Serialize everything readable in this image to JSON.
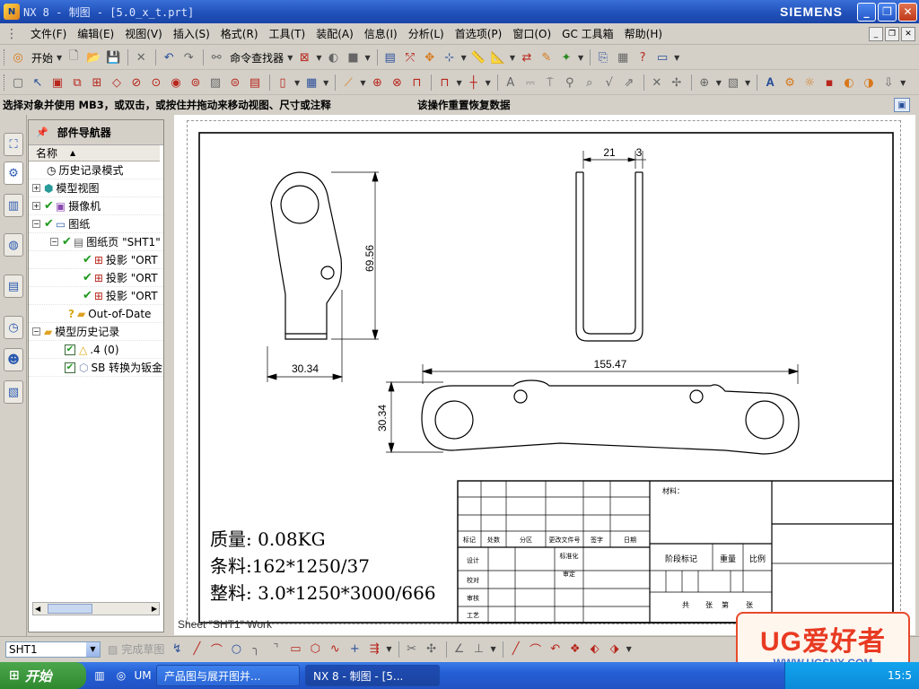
{
  "window": {
    "title": "NX 8 - 制图 - [5.0_x_t.prt]",
    "brand": "SIEMENS",
    "buttons": {
      "minimize": "_",
      "restore": "❐",
      "close": "✕"
    }
  },
  "menu": {
    "items": [
      "文件(F)",
      "编辑(E)",
      "视图(V)",
      "插入(S)",
      "格式(R)",
      "工具(T)",
      "装配(A)",
      "信息(I)",
      "分析(L)",
      "首选项(P)",
      "窗口(O)",
      "GC 工具箱",
      "帮助(H)"
    ]
  },
  "toolbar1": {
    "start_label": "开始",
    "command_finder_label": "命令查找器"
  },
  "status": {
    "cue": "选择对象并使用 MB3，或双击，或按住并拖动来移动视图、尺寸或注释",
    "message": "该操作重置恢复数据"
  },
  "navigator": {
    "title": "部件导航器",
    "column_header": "名称",
    "rows": [
      {
        "label": "历史记录模式"
      },
      {
        "label": "模型视图"
      },
      {
        "label": "摄像机"
      },
      {
        "label": "图纸"
      },
      {
        "label": "图纸页 \"SHT1\""
      },
      {
        "label": "投影 \"ORT"
      },
      {
        "label": "投影 \"ORT"
      },
      {
        "label": "投影 \"ORT"
      },
      {
        "label": "Out-of-Date"
      },
      {
        "label": "模型历史记录"
      },
      {
        "label": ".4 (0)"
      },
      {
        "label": "SB 转换为钣金"
      }
    ]
  },
  "drawing": {
    "dimensions": {
      "top_width": "21",
      "top_thickness": "3",
      "side_height": "69.56",
      "side_width": "30.34",
      "flat_length": "155.47",
      "flat_height": "30.34"
    },
    "notes": {
      "mass": "质量: 0.08KG",
      "strip": "条料:162*1250/37",
      "sheet": "整料: 3.0*1250*3000/666"
    },
    "title_block": {
      "material": "材料：",
      "headers": [
        "标记",
        "处数",
        "分区",
        "更改文件号",
        "签字",
        "日期"
      ],
      "roles": [
        "设计",
        "校对",
        "审核",
        "工艺"
      ],
      "standardize": "标准化",
      "approve": "审定",
      "stage_mark": "阶段标记",
      "weight": "重量",
      "scale": "比例",
      "sheets": [
        "共",
        "张",
        "第",
        "张"
      ]
    },
    "sheet_label": "Sheet \"SHT1\" Work"
  },
  "bottom_toolbar": {
    "sheet_value": "SHT1",
    "finish_sketch": "完成草图"
  },
  "watermark": {
    "text": "UG爱好者",
    "url": "WWW.UGSNX.COM"
  },
  "taskbar": {
    "start": "开始",
    "tasks": [
      "产品图与展开图并...",
      "NX 8 - 制图 - [5..."
    ],
    "clock": "15:5"
  }
}
